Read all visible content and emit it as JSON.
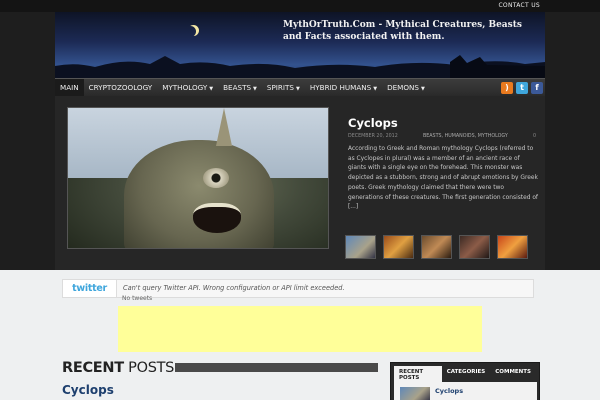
{
  "topbar": {
    "contact_label": "CONTACT US"
  },
  "header": {
    "site_title": "MythOrTruth.Com - Mythical Creatures, Beasts and Facts associated with them."
  },
  "nav": {
    "items": [
      {
        "label": "MAIN",
        "dropdown": false,
        "active": true
      },
      {
        "label": "CRYPTOZOOLOGY",
        "dropdown": false
      },
      {
        "label": "MYTHOLOGY",
        "dropdown": true
      },
      {
        "label": "BEASTS",
        "dropdown": true
      },
      {
        "label": "SPIRITS",
        "dropdown": true
      },
      {
        "label": "HYBRID  HUMANS",
        "dropdown": true
      },
      {
        "label": "DEMONS",
        "dropdown": true
      }
    ],
    "social": [
      {
        "name": "rss-icon",
        "glyph": ")"
      },
      {
        "name": "twitter-icon",
        "glyph": "t"
      },
      {
        "name": "facebook-icon",
        "glyph": "f"
      }
    ]
  },
  "featured": {
    "title": "Cyclops",
    "date": "DECEMBER 20, 2012",
    "tags": "BEASTS, HUMANOIDS, MYTHOLOGY",
    "comments": "0",
    "excerpt": "According to Greek and Roman mythology Cyclops (referred to as Cyclopes in plural) was a member of an ancient race of giants with a single eye on the forehead. This monster was depicted as a stubborn, strong and of abrupt emotions by Greek poets. Greek mythology claimed that there were two generations of these creatures. The first generation consisted of [...]"
  },
  "twitter": {
    "logo": "twitter",
    "message": "Can't query Twitter API. Wrong configuration or API limit exceeded.",
    "sub": "No tweets"
  },
  "recent": {
    "heading_bold": "RECENT",
    "heading_rest": " POSTS",
    "first_post": "Cyclops"
  },
  "sidebar": {
    "tabs": [
      {
        "label": "RECENT POSTS",
        "active": true
      },
      {
        "label": "CATEGORIES",
        "active": false
      },
      {
        "label": "COMMENTS",
        "active": false
      }
    ],
    "first_item": "Cyclops"
  },
  "colors": {
    "nav_bg": "#2a2a2a",
    "link": "#1d3f6e",
    "ad": "#ffff99",
    "twitter": "#3fa6dc"
  }
}
